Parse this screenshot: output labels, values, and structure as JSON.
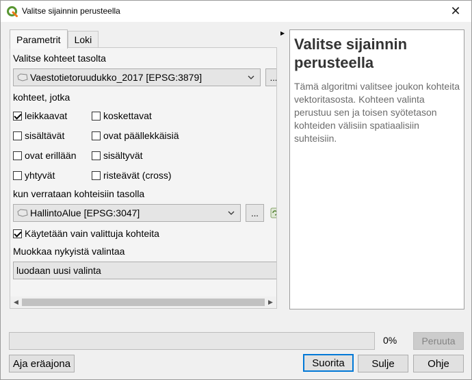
{
  "window": {
    "title": "Valitse sijainnin perusteella",
    "close_symbol": "✕",
    "icon": "qgis-logo-icon"
  },
  "tabs": [
    {
      "label": "Parametrit",
      "active": true
    },
    {
      "label": "Loki",
      "active": false
    }
  ],
  "params": {
    "input_layer_label": "Valitse kohteet tasolta",
    "input_layer_value": "Vaestotietoruudukko_2017 [EPSG:3879]",
    "input_layer_btn": "...",
    "predicate_label": "kohteet, jotka",
    "predicates": [
      {
        "label": "leikkaavat",
        "checked": true
      },
      {
        "label": "koskettavat",
        "checked": false
      },
      {
        "label": "sisältävät",
        "checked": false
      },
      {
        "label": "ovat päällekkäisiä",
        "checked": false
      },
      {
        "label": "ovat erillään",
        "checked": false
      },
      {
        "label": "sisältyvät",
        "checked": false
      },
      {
        "label": "yhtyvät",
        "checked": false
      },
      {
        "label": "risteävät (cross)",
        "checked": false
      }
    ],
    "compare_layer_label": "kun verrataan kohteisiin tasolla",
    "compare_layer_value": "HallintoAlue [EPSG:3047]",
    "compare_layer_btn": "...",
    "selected_only_label": "Käytetään vain valittuja kohteita",
    "selected_only_checked": true,
    "modify_label": "Muokkaa nykyistä valintaa",
    "modify_value": "luodaan uusi valinta"
  },
  "help": {
    "title": "Valitse sijainnin perusteella",
    "text": "Tämä algoritmi valitsee joukon kohteita vektoritasosta. Kohteen valinta perustuu sen ja toisen syötetason kohteiden välisiin spatiaalisiin suhteisiin."
  },
  "progress": {
    "value": 0,
    "label": "0%"
  },
  "buttons": {
    "cancel": "Peruuta",
    "batch": "Aja eräajona",
    "run": "Suorita",
    "close": "Sulje",
    "help": "Ohje"
  }
}
